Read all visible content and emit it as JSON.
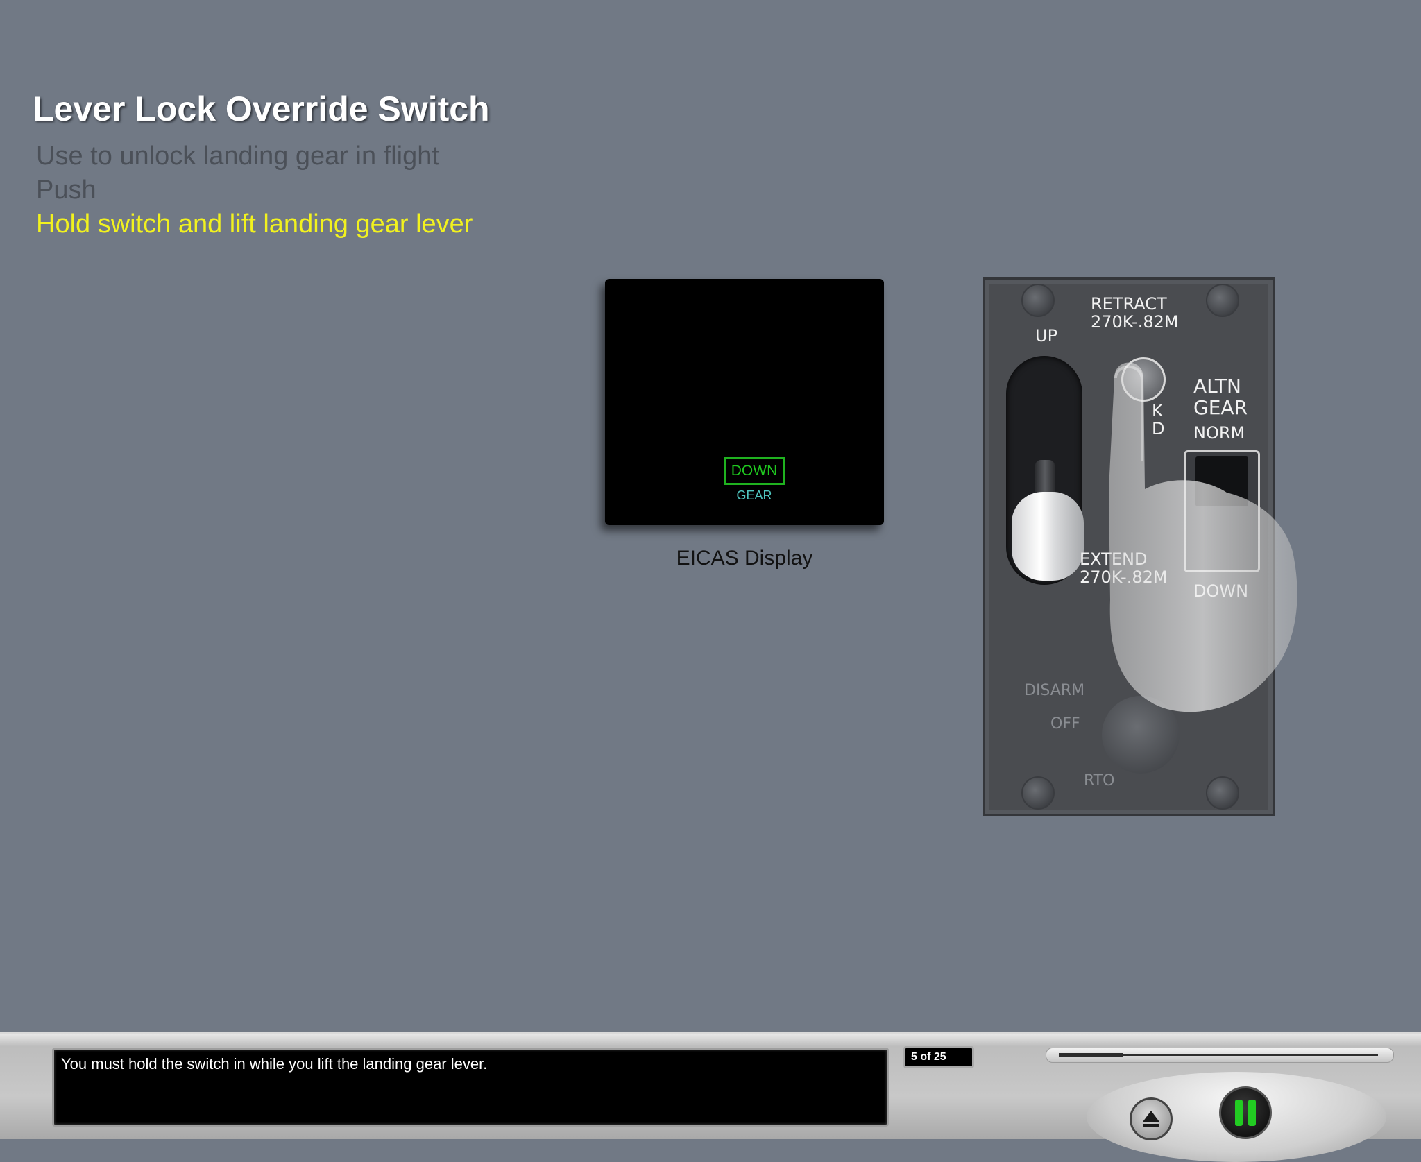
{
  "lesson": {
    "title": "Lever Lock Override Switch",
    "steps": [
      {
        "text": "Use to unlock landing gear in flight",
        "state": "done"
      },
      {
        "text": "Push",
        "state": "done"
      },
      {
        "text": "Hold switch and lift landing gear lever",
        "state": "current"
      }
    ]
  },
  "eicas": {
    "status": "DOWN",
    "label": "GEAR",
    "caption": "EICAS Display"
  },
  "gear_panel": {
    "retract_line1": "RETRACT",
    "retract_line2": "270K-.82M",
    "up": "UP",
    "lock_fragment_line1": "K",
    "lock_fragment_line2": "D",
    "altn_line1": "ALTN",
    "altn_line2": "GEAR",
    "norm": "NORM",
    "extend_line1": "EXTEND",
    "extend_line2": "270K-.82M",
    "down": "DOWN",
    "disarm": "DISARM",
    "off": "OFF",
    "rto": "RTO"
  },
  "player": {
    "caption": "You must hold the switch in while you lift the landing gear lever.",
    "page_counter": "5 of 25",
    "progress_fraction": 0.2
  },
  "icons": {
    "eject": "eject-icon",
    "pause": "pause-icon"
  },
  "colors": {
    "background": "#717985",
    "current_step": "#f2f21e",
    "eicas_green": "#1fc71f",
    "eicas_cyan": "#4fc7c0",
    "pause_green": "#22cc22"
  }
}
